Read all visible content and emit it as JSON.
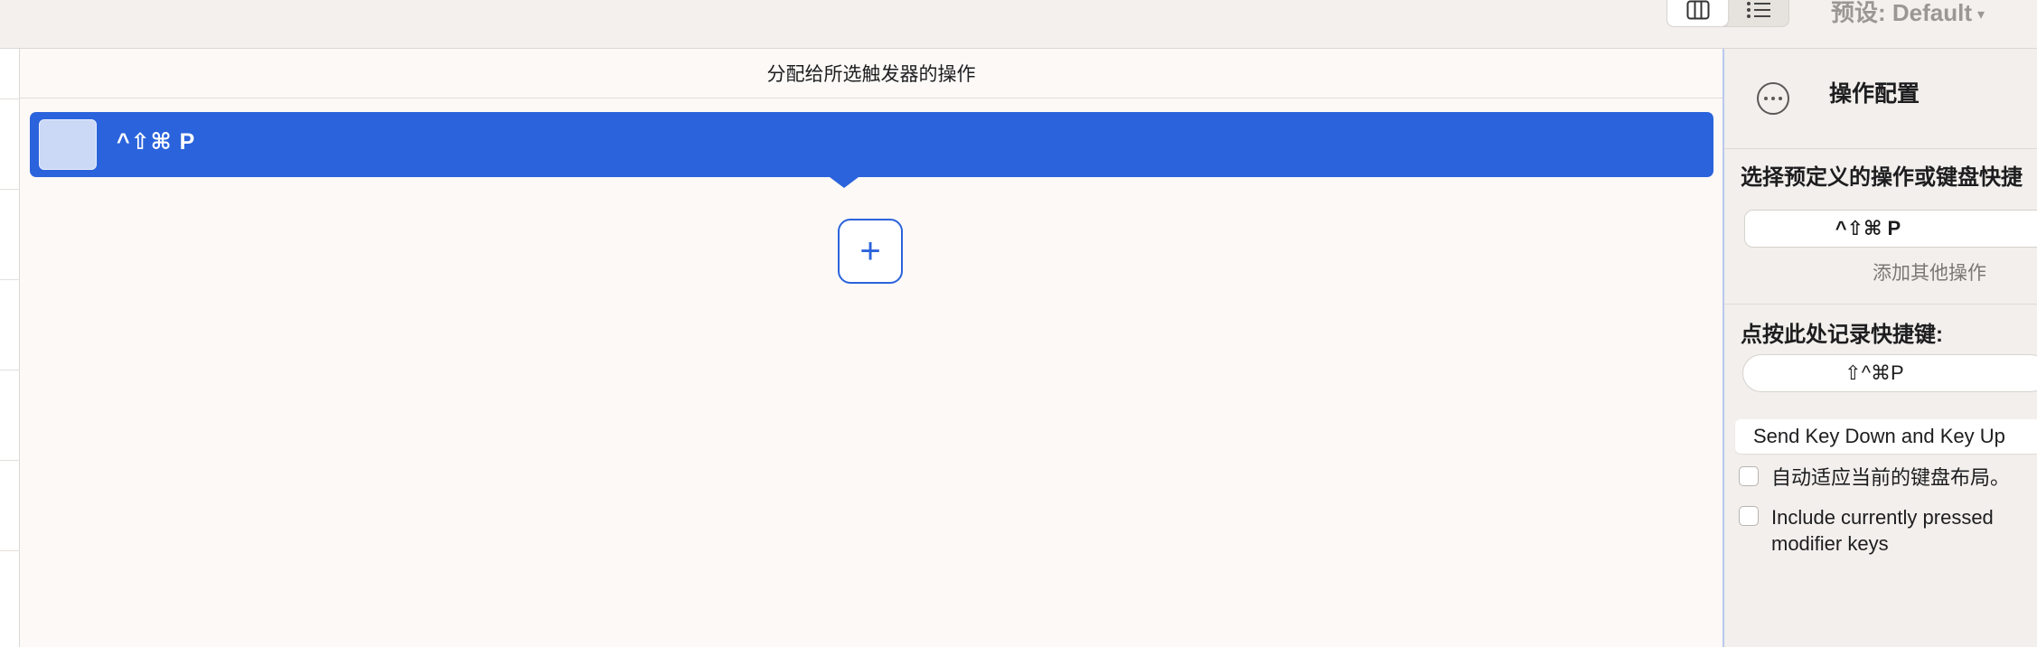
{
  "toolbar": {
    "preset_label": "预设: Default",
    "preset_caret": "▾",
    "view_toggle": {
      "active": "columns-view"
    }
  },
  "center": {
    "header": "分配给所选触发器的操作",
    "actions": [
      {
        "label": "^⇧⌘ P"
      }
    ],
    "add_label": "+"
  },
  "inspector": {
    "title": "操作配置",
    "predefined_label": "选择预定义的操作或键盘快捷",
    "predefined_value": "^⇧⌘ P",
    "add_other_action": "添加其他操作",
    "record_label": "点按此处记录快捷键:",
    "record_value": "⇧^⌘P",
    "send_mode": "Send Key Down and Key Up",
    "checkbox_auto_layout": "自动适应当前的键盘布局。",
    "checkbox_include_modifiers": "Include currently pressed modifier keys"
  },
  "colors": {
    "accent": "#2b63dc",
    "background": "#fcf9f7",
    "inspector_bg": "#f2efec"
  }
}
